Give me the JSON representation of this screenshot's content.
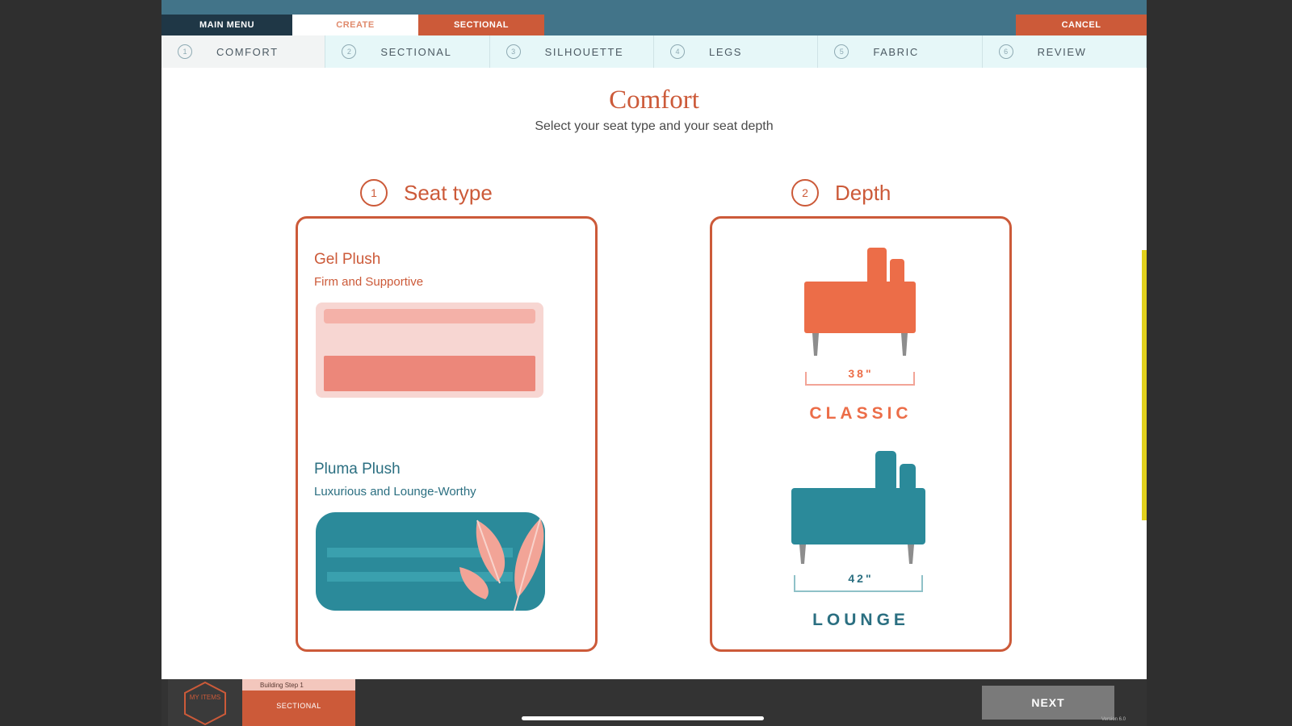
{
  "topbar": {
    "tabs": [
      "MAIN MENU",
      "CREATE",
      "SECTIONAL"
    ],
    "cancel_label": "CANCEL"
  },
  "steps": [
    {
      "num": "1",
      "label": "COMFORT"
    },
    {
      "num": "2",
      "label": "SECTIONAL"
    },
    {
      "num": "3",
      "label": "SILHOUETTE"
    },
    {
      "num": "4",
      "label": "LEGS"
    },
    {
      "num": "5",
      "label": "FABRIC"
    },
    {
      "num": "6",
      "label": "REVIEW"
    }
  ],
  "page": {
    "title": "Comfort",
    "subtitle": "Select your seat type and your seat depth"
  },
  "seat": {
    "num": "1",
    "heading": "Seat type",
    "options": [
      {
        "title": "Gel Plush",
        "subtitle": "Firm and Supportive"
      },
      {
        "title": "Pluma Plush",
        "subtitle": "Luxurious and Lounge-Worthy"
      }
    ]
  },
  "depth": {
    "num": "2",
    "heading": "Depth",
    "options": [
      {
        "dimension": "38\"",
        "label": "CLASSIC"
      },
      {
        "dimension": "42\"",
        "label": "LOUNGE"
      }
    ]
  },
  "bottombar": {
    "my_items": "MY ITEMS",
    "build_step": "Building Step 1",
    "build_name": "SECTIONAL",
    "next_label": "NEXT",
    "tiny_text": "Version 6.0"
  },
  "colors": {
    "accent": "#cc5a39",
    "teal": "#2b6f81",
    "topbar": "#427489",
    "gel_light": "#f7d6d2",
    "gel_dark": "#ec877a"
  },
  "icons": {
    "my_items": "hexagon-icon",
    "gel": "gel-cushion-icon",
    "pluma": "feather-cushion-icon",
    "classic": "classic-sofa-icon",
    "lounge": "lounge-sofa-icon"
  }
}
